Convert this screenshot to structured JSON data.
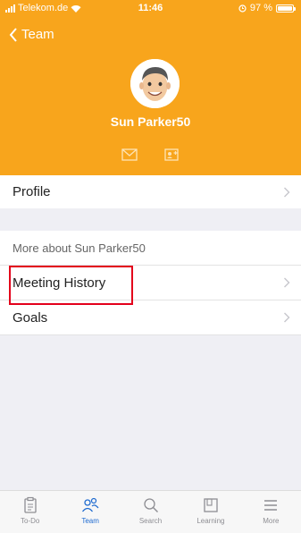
{
  "status_bar": {
    "carrier": "Telekom.de",
    "time": "11:46",
    "battery": "97 %"
  },
  "header": {
    "back_label": "Team",
    "user_name": "Sun Parker50"
  },
  "menu": {
    "profile_label": "Profile",
    "section_title": "More about Sun Parker50",
    "meeting_history_label": "Meeting History",
    "goals_label": "Goals"
  },
  "tabbar": {
    "tabs": [
      {
        "label": "To-Do",
        "icon": "clipboard-icon"
      },
      {
        "label": "Team",
        "icon": "people-icon"
      },
      {
        "label": "Search",
        "icon": "search-icon"
      },
      {
        "label": "Learning",
        "icon": "book-icon"
      },
      {
        "label": "More",
        "icon": "menu-icon"
      }
    ],
    "active_tab": "Team"
  },
  "colors": {
    "header": "#f8a51c",
    "active_tab": "#1f6bd0",
    "highlight": "#e3001b"
  }
}
